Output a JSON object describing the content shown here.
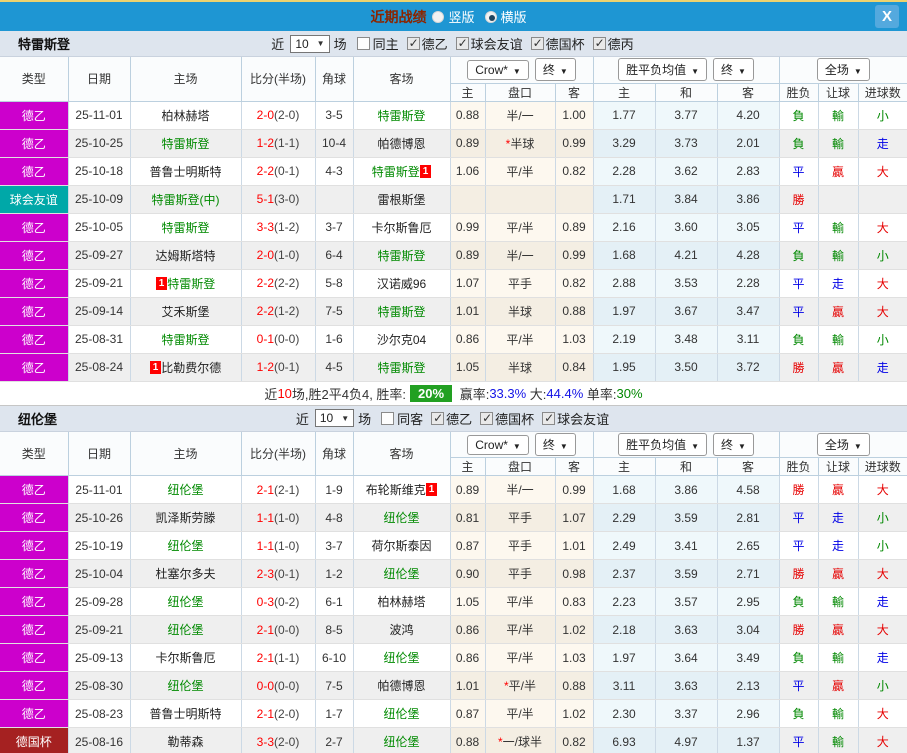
{
  "titlebar": {
    "title": "近期战绩",
    "radios": [
      {
        "label": "竖版",
        "selected": false
      },
      {
        "label": "横版",
        "selected": true
      }
    ],
    "close_label": "X"
  },
  "columns": {
    "type": "类型",
    "date": "日期",
    "home": "主场",
    "score": "比分(半场)",
    "corner": "角球",
    "away": "客场",
    "dropdowns": {
      "company": "Crow*",
      "final1": "终",
      "avg": "胜平负均值",
      "final2": "终",
      "full": "全场"
    },
    "sub": [
      "主",
      "盘口",
      "客",
      "主",
      "和",
      "客",
      "胜负",
      "让球",
      "进球数"
    ]
  },
  "badge_text": "1",
  "result_colors": {
    "勝": "red",
    "贏": "red",
    "大": "red",
    "平": "blue",
    "走": "blue",
    "負": "green",
    "輸": "green",
    "小": "green"
  },
  "type_colors": {
    "de2": "#CC00CC",
    "friendly": "#00A8A8",
    "decup": "#A52121"
  },
  "sections": [
    {
      "team": "特雷斯登",
      "filter": {
        "near": "近",
        "count": "10",
        "games": "场",
        "same_label": "同主",
        "same_checked": false,
        "leagues": [
          {
            "label": "德乙",
            "checked": true
          },
          {
            "label": "球会友谊",
            "checked": true
          },
          {
            "label": "德国杯",
            "checked": true
          },
          {
            "label": "德丙",
            "checked": true
          }
        ]
      },
      "rows": [
        {
          "t": "德乙",
          "tk": "de2",
          "d": "25-11-01",
          "h": "柏林赫塔",
          "hh": false,
          "hb": null,
          "s": "2-0",
          "sh": "(2-0)",
          "c": "3-5",
          "a": "特雷斯登",
          "ah": true,
          "ab": null,
          "o1": "0.88",
          "o2": "半/一",
          "star": false,
          "o3": "1.00",
          "m1": "1.77",
          "m2": "3.77",
          "m3": "4.20",
          "r1": "負",
          "r2": "輸",
          "r3": "小"
        },
        {
          "t": "德乙",
          "tk": "de2",
          "d": "25-10-25",
          "h": "特雷斯登",
          "hh": true,
          "hb": null,
          "s": "1-2",
          "sh": "(1-1)",
          "c": "10-4",
          "a": "帕德博恩",
          "ah": false,
          "ab": null,
          "o1": "0.89",
          "o2": "半球",
          "star": true,
          "o3": "0.99",
          "m1": "3.29",
          "m2": "3.73",
          "m3": "2.01",
          "r1": "負",
          "r2": "輸",
          "r3": "走"
        },
        {
          "t": "德乙",
          "tk": "de2",
          "d": "25-10-18",
          "h": "普鲁士明斯特",
          "hh": false,
          "hb": null,
          "s": "2-2",
          "sh": "(0-1)",
          "c": "4-3",
          "a": "特雷斯登",
          "ah": true,
          "ab": "post",
          "o1": "1.06",
          "o2": "平/半",
          "star": false,
          "o3": "0.82",
          "m1": "2.28",
          "m2": "3.62",
          "m3": "2.83",
          "r1": "平",
          "r2": "贏",
          "r3": "大"
        },
        {
          "t": "球会友谊",
          "tk": "friendly",
          "d": "25-10-09",
          "h": "特雷斯登(中)",
          "hh": true,
          "hb": null,
          "s": "5-1",
          "sh": "(3-0)",
          "c": "",
          "a": "雷根斯堡",
          "ah": false,
          "ab": null,
          "o1": "",
          "o2": "",
          "star": false,
          "o3": "",
          "m1": "1.71",
          "m2": "3.84",
          "m3": "3.86",
          "r1": "勝",
          "r2": "",
          "r3": ""
        },
        {
          "t": "德乙",
          "tk": "de2",
          "d": "25-10-05",
          "h": "特雷斯登",
          "hh": true,
          "hb": null,
          "s": "3-3",
          "sh": "(1-2)",
          "c": "3-7",
          "a": "卡尔斯鲁厄",
          "ah": false,
          "ab": null,
          "o1": "0.99",
          "o2": "平/半",
          "star": false,
          "o3": "0.89",
          "m1": "2.16",
          "m2": "3.60",
          "m3": "3.05",
          "r1": "平",
          "r2": "輸",
          "r3": "大"
        },
        {
          "t": "德乙",
          "tk": "de2",
          "d": "25-09-27",
          "h": "达姆斯塔特",
          "hh": false,
          "hb": null,
          "s": "2-0",
          "sh": "(1-0)",
          "c": "6-4",
          "a": "特雷斯登",
          "ah": true,
          "ab": null,
          "o1": "0.89",
          "o2": "半/一",
          "star": false,
          "o3": "0.99",
          "m1": "1.68",
          "m2": "4.21",
          "m3": "4.28",
          "r1": "負",
          "r2": "輸",
          "r3": "小"
        },
        {
          "t": "德乙",
          "tk": "de2",
          "d": "25-09-21",
          "h": "特雷斯登",
          "hh": true,
          "hb": "pre",
          "s": "2-2",
          "sh": "(2-2)",
          "c": "5-8",
          "a": "汉诺威96",
          "ah": false,
          "ab": null,
          "o1": "1.07",
          "o2": "平手",
          "star": false,
          "o3": "0.82",
          "m1": "2.88",
          "m2": "3.53",
          "m3": "2.28",
          "r1": "平",
          "r2": "走",
          "r3": "大"
        },
        {
          "t": "德乙",
          "tk": "de2",
          "d": "25-09-14",
          "h": "艾禾斯堡",
          "hh": false,
          "hb": null,
          "s": "2-2",
          "sh": "(1-2)",
          "c": "7-5",
          "a": "特雷斯登",
          "ah": true,
          "ab": null,
          "o1": "1.01",
          "o2": "半球",
          "star": false,
          "o3": "0.88",
          "m1": "1.97",
          "m2": "3.67",
          "m3": "3.47",
          "r1": "平",
          "r2": "贏",
          "r3": "大"
        },
        {
          "t": "德乙",
          "tk": "de2",
          "d": "25-08-31",
          "h": "特雷斯登",
          "hh": true,
          "hb": null,
          "s": "0-1",
          "sh": "(0-0)",
          "c": "1-6",
          "a": "沙尔克04",
          "ah": false,
          "ab": null,
          "o1": "0.86",
          "o2": "平/半",
          "star": false,
          "o3": "1.03",
          "m1": "2.19",
          "m2": "3.48",
          "m3": "3.11",
          "r1": "負",
          "r2": "輸",
          "r3": "小"
        },
        {
          "t": "德乙",
          "tk": "de2",
          "d": "25-08-24",
          "h": "比勒费尔德",
          "hh": false,
          "hb": "pre",
          "s": "1-2",
          "sh": "(0-1)",
          "c": "4-5",
          "a": "特雷斯登",
          "ah": true,
          "ab": null,
          "o1": "1.05",
          "o2": "半球",
          "star": false,
          "o3": "0.84",
          "m1": "1.95",
          "m2": "3.50",
          "m3": "3.72",
          "r1": "勝",
          "r2": "贏",
          "r3": "走"
        }
      ],
      "summary": [
        {
          "t": "近"
        },
        {
          "t": "10",
          "cls": "red"
        },
        {
          "t": "场,胜2平4负4, 胜率:"
        },
        {
          "t": "20%",
          "cls": "badge"
        },
        {
          "t": " 赢率:"
        },
        {
          "t": "33.3%",
          "cls": "blue"
        },
        {
          "t": " 大:"
        },
        {
          "t": "44.4%",
          "cls": "blue"
        },
        {
          "t": " 单率:"
        },
        {
          "t": "30%",
          "cls": "green"
        }
      ]
    },
    {
      "team": "纽伦堡",
      "filter": {
        "near": "近",
        "count": "10",
        "games": "场",
        "same_label": "同客",
        "same_checked": false,
        "leagues": [
          {
            "label": "德乙",
            "checked": true
          },
          {
            "label": "德国杯",
            "checked": true
          },
          {
            "label": "球会友谊",
            "checked": true
          }
        ]
      },
      "rows": [
        {
          "t": "德乙",
          "tk": "de2",
          "d": "25-11-01",
          "h": "纽伦堡",
          "hh": true,
          "hb": null,
          "s": "2-1",
          "sh": "(2-1)",
          "c": "1-9",
          "a": "布轮斯维克",
          "ah": false,
          "ab": "post",
          "o1": "0.89",
          "o2": "半/一",
          "star": false,
          "o3": "0.99",
          "m1": "1.68",
          "m2": "3.86",
          "m3": "4.58",
          "r1": "勝",
          "r2": "贏",
          "r3": "大"
        },
        {
          "t": "德乙",
          "tk": "de2",
          "d": "25-10-26",
          "h": "凯泽斯劳滕",
          "hh": false,
          "hb": null,
          "s": "1-1",
          "sh": "(1-0)",
          "c": "4-8",
          "a": "纽伦堡",
          "ah": true,
          "ab": null,
          "o1": "0.81",
          "o2": "平手",
          "star": false,
          "o3": "1.07",
          "m1": "2.29",
          "m2": "3.59",
          "m3": "2.81",
          "r1": "平",
          "r2": "走",
          "r3": "小"
        },
        {
          "t": "德乙",
          "tk": "de2",
          "d": "25-10-19",
          "h": "纽伦堡",
          "hh": true,
          "hb": null,
          "s": "1-1",
          "sh": "(1-0)",
          "c": "3-7",
          "a": "荷尔斯泰因",
          "ah": false,
          "ab": null,
          "o1": "0.87",
          "o2": "平手",
          "star": false,
          "o3": "1.01",
          "m1": "2.49",
          "m2": "3.41",
          "m3": "2.65",
          "r1": "平",
          "r2": "走",
          "r3": "小"
        },
        {
          "t": "德乙",
          "tk": "de2",
          "d": "25-10-04",
          "h": "杜塞尔多夫",
          "hh": false,
          "hb": null,
          "s": "2-3",
          "sh": "(0-1)",
          "c": "1-2",
          "a": "纽伦堡",
          "ah": true,
          "ab": null,
          "o1": "0.90",
          "o2": "平手",
          "star": false,
          "o3": "0.98",
          "m1": "2.37",
          "m2": "3.59",
          "m3": "2.71",
          "r1": "勝",
          "r2": "贏",
          "r3": "大"
        },
        {
          "t": "德乙",
          "tk": "de2",
          "d": "25-09-28",
          "h": "纽伦堡",
          "hh": true,
          "hb": null,
          "s": "0-3",
          "sh": "(0-2)",
          "c": "6-1",
          "a": "柏林赫塔",
          "ah": false,
          "ab": null,
          "o1": "1.05",
          "o2": "平/半",
          "star": false,
          "o3": "0.83",
          "m1": "2.23",
          "m2": "3.57",
          "m3": "2.95",
          "r1": "負",
          "r2": "輸",
          "r3": "走"
        },
        {
          "t": "德乙",
          "tk": "de2",
          "d": "25-09-21",
          "h": "纽伦堡",
          "hh": true,
          "hb": null,
          "s": "2-1",
          "sh": "(0-0)",
          "c": "8-5",
          "a": "波鸿",
          "ah": false,
          "ab": null,
          "o1": "0.86",
          "o2": "平/半",
          "star": false,
          "o3": "1.02",
          "m1": "2.18",
          "m2": "3.63",
          "m3": "3.04",
          "r1": "勝",
          "r2": "贏",
          "r3": "大"
        },
        {
          "t": "德乙",
          "tk": "de2",
          "d": "25-09-13",
          "h": "卡尔斯鲁厄",
          "hh": false,
          "hb": null,
          "s": "2-1",
          "sh": "(1-1)",
          "c": "6-10",
          "a": "纽伦堡",
          "ah": true,
          "ab": null,
          "o1": "0.86",
          "o2": "平/半",
          "star": false,
          "o3": "1.03",
          "m1": "1.97",
          "m2": "3.64",
          "m3": "3.49",
          "r1": "負",
          "r2": "輸",
          "r3": "走"
        },
        {
          "t": "德乙",
          "tk": "de2",
          "d": "25-08-30",
          "h": "纽伦堡",
          "hh": true,
          "hb": null,
          "s": "0-0",
          "sh": "(0-0)",
          "c": "7-5",
          "a": "帕德博恩",
          "ah": false,
          "ab": null,
          "o1": "1.01",
          "o2": "平/半",
          "star": true,
          "o3": "0.88",
          "m1": "3.11",
          "m2": "3.63",
          "m3": "2.13",
          "r1": "平",
          "r2": "贏",
          "r3": "小"
        },
        {
          "t": "德乙",
          "tk": "de2",
          "d": "25-08-23",
          "h": "普鲁士明斯特",
          "hh": false,
          "hb": null,
          "s": "2-1",
          "sh": "(2-0)",
          "c": "1-7",
          "a": "纽伦堡",
          "ah": true,
          "ab": null,
          "o1": "0.87",
          "o2": "平/半",
          "star": false,
          "o3": "1.02",
          "m1": "2.30",
          "m2": "3.37",
          "m3": "2.96",
          "r1": "負",
          "r2": "輸",
          "r3": "大"
        },
        {
          "t": "德国杯",
          "tk": "decup",
          "d": "25-08-16",
          "h": "勒蒂森",
          "hh": false,
          "hb": null,
          "s": "3-3",
          "sh": "(2-0)",
          "c": "2-7",
          "a": "纽伦堡",
          "ah": true,
          "ab": null,
          "o1": "0.88",
          "o2": "一/球半",
          "star": true,
          "o3": "0.82",
          "m1": "6.93",
          "m2": "4.97",
          "m3": "1.37",
          "r1": "平",
          "r2": "輸",
          "r3": "大"
        }
      ],
      "summary": null
    }
  ]
}
